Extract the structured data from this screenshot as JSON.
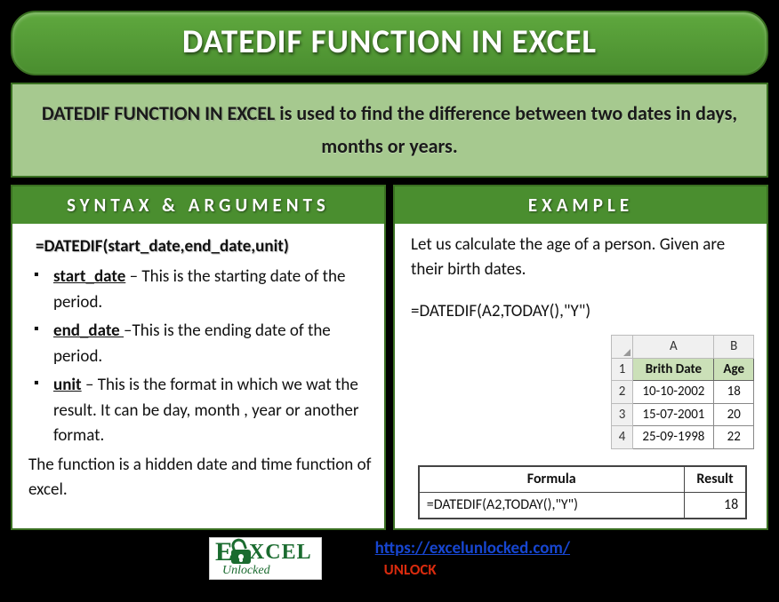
{
  "title": "DATEDIF FUNCTION IN EXCEL",
  "description": {
    "bold": "DATEDIF FUNCTION IN EXCEL",
    "rest": " is used to find the difference between two dates in days, months or years."
  },
  "syntax": {
    "header": "SYNTAX & ARGUMENTS",
    "formula": "=DATEDIF(start_date,end_date,unit)",
    "args": [
      {
        "name": "start_date",
        "desc": " – This is the starting date of the period."
      },
      {
        "name": "end_date ",
        "desc": "–This is the ending date of the period."
      },
      {
        "name": "unit",
        "desc": " – This is the format in which we wat the result. It can be day, month , year or another format."
      }
    ],
    "note": "The function is a hidden date and time function of excel."
  },
  "example": {
    "header": "EXAMPLE",
    "intro": "Let us calculate the age of a person. Given are their birth dates.",
    "formula": "=DATEDIF(A2,TODAY(),\"Y\")",
    "grid": {
      "cols": [
        "A",
        "B"
      ],
      "rows": [
        "1",
        "2",
        "3",
        "4"
      ],
      "headers": [
        "Brith Date",
        "Age"
      ],
      "data": [
        [
          "10-10-2002",
          "18"
        ],
        [
          "15-07-2001",
          "20"
        ],
        [
          "25-09-1998",
          "22"
        ]
      ]
    },
    "result": {
      "headers": [
        "Formula",
        "Result"
      ],
      "row": [
        "=DATEDIF(A2,TODAY(),\"Y\")",
        "18"
      ]
    }
  },
  "footer": {
    "logo_top": "XCEL",
    "logo_e": "E",
    "logo_bottom": "Unlocked",
    "link": "https://excelunlocked.com/",
    "unlock": "UNLOCK"
  }
}
